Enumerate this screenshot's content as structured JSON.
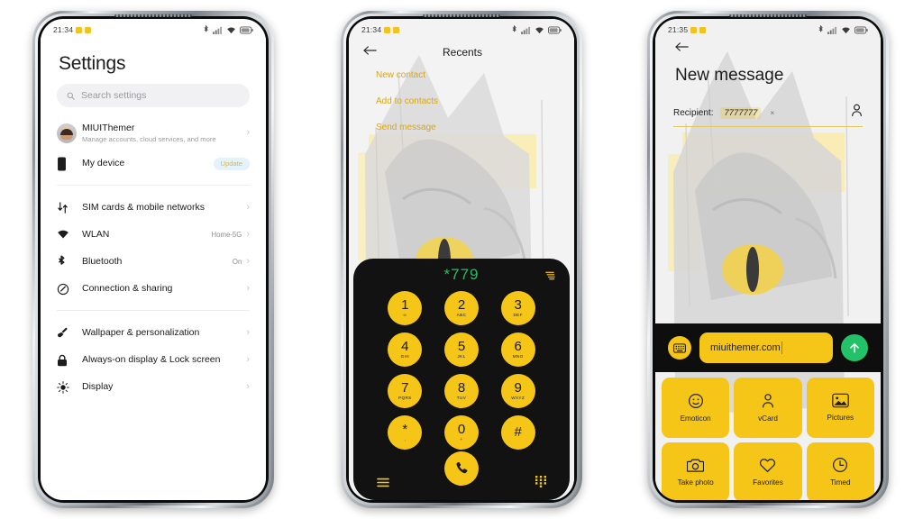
{
  "phones": {
    "settings": {
      "status": {
        "time": "21:34",
        "notif_icons": [
          "notification-dot",
          "notification-dot"
        ],
        "right_icons": [
          "bluetooth-icon",
          "signal-icon",
          "wifi-icon",
          "battery-icon"
        ]
      },
      "title": "Settings",
      "search": {
        "placeholder": "Search settings",
        "icon": "search-icon"
      },
      "account": {
        "name": "MIUIThemer",
        "subtitle": "Manage accounts, cloud services, and more",
        "avatar": "user-avatar"
      },
      "device": {
        "label": "My device",
        "badge": "Update",
        "icon": "phone-icon",
        "badge_bg": "#e3f2fb",
        "badge_fg": "#e8b81d"
      },
      "items": [
        {
          "label": "SIM cards & mobile networks",
          "value": "",
          "icon": "sim-icon"
        },
        {
          "label": "WLAN",
          "value": "Home-5G",
          "icon": "wifi-icon"
        },
        {
          "label": "Bluetooth",
          "value": "On",
          "icon": "bluetooth-icon"
        },
        {
          "label": "Connection & sharing",
          "value": "",
          "icon": "link-icon"
        }
      ],
      "items2": [
        {
          "label": "Wallpaper & personalization",
          "value": "",
          "icon": "brush-icon"
        },
        {
          "label": "Always-on display & Lock screen",
          "value": "",
          "icon": "lock-icon"
        },
        {
          "label": "Display",
          "value": "",
          "icon": "brightness-icon"
        }
      ]
    },
    "dialer": {
      "status": {
        "time": "21:34",
        "notif_icons": [
          "notification-dot",
          "notification-dot"
        ],
        "right_icons": [
          "bluetooth-icon",
          "signal-icon",
          "wifi-icon",
          "battery-icon"
        ]
      },
      "header": {
        "back": "back-arrow-icon",
        "title": "Recents"
      },
      "menu_items": [
        "New contact",
        "Add to contacts",
        "Send message"
      ],
      "number": "*779",
      "number_color": "#25c05d",
      "delete_icon": "backspace-icon",
      "keys": [
        {
          "digit": "1",
          "letters": "∞"
        },
        {
          "digit": "2",
          "letters": "ABC"
        },
        {
          "digit": "3",
          "letters": "DEF"
        },
        {
          "digit": "4",
          "letters": "GHI"
        },
        {
          "digit": "5",
          "letters": "JKL"
        },
        {
          "digit": "6",
          "letters": "MNO"
        },
        {
          "digit": "7",
          "letters": "PQRS"
        },
        {
          "digit": "8",
          "letters": "TUV"
        },
        {
          "digit": "9",
          "letters": "WXYZ"
        },
        {
          "digit": "*",
          "letters": ","
        },
        {
          "digit": "0",
          "letters": "+"
        },
        {
          "digit": "#",
          "letters": ""
        }
      ],
      "call_icon": "call-icon",
      "left_icon": "menu-icon",
      "right_icon": "keypad-icon",
      "key_bg": "#f5c518"
    },
    "message": {
      "status": {
        "time": "21:35",
        "notif_icons": [
          "notification-dot",
          "notification-dot"
        ],
        "right_icons": [
          "bluetooth-icon",
          "signal-icon",
          "wifi-icon",
          "battery-icon"
        ]
      },
      "back": "back-arrow-icon",
      "title": "New message",
      "recipient": {
        "label": "Recipient:",
        "value": "7777777",
        "remove": "×",
        "contact_icon": "contact-picker-icon"
      },
      "compose": {
        "keyboard_icon": "keyboard-icon",
        "text": "miuithemer.com",
        "send_icon": "send-arrow-icon",
        "send_bg": "#23c268",
        "input_bg": "#f5c518"
      },
      "attachments": [
        {
          "label": "Emoticon",
          "icon": "emoticon-icon"
        },
        {
          "label": "vCard",
          "icon": "vcard-icon"
        },
        {
          "label": "Pictures",
          "icon": "pictures-icon"
        },
        {
          "label": "Take photo",
          "icon": "camera-icon"
        },
        {
          "label": "Favorites",
          "icon": "heart-icon"
        },
        {
          "label": "Timed",
          "icon": "clock-icon"
        }
      ],
      "page_dots": {
        "count": 3,
        "active": 1
      }
    }
  }
}
